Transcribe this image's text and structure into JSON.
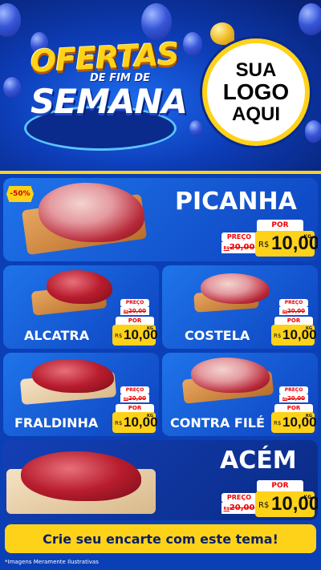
{
  "header": {
    "title_line1": "OFERTAS",
    "title_line2": "DE FIM DE",
    "title_line3": "SEMANA",
    "logo_line1": "SUA",
    "logo_line2": "LOGO",
    "logo_line3": "AQUI"
  },
  "colors": {
    "background": "#0b3fb5",
    "accent_yellow": "#ffd21a",
    "price_red": "#e00000"
  },
  "discount_badge": "-50%",
  "products": [
    {
      "name": "PICANHA",
      "preco_label": "PREÇO",
      "old_price": "20,00",
      "old_prefix": "R$",
      "por_label": "POR",
      "currency": "R$",
      "price": "10,00",
      "unit": "KG"
    },
    {
      "name": "ALCATRA",
      "preco_label": "PREÇO",
      "old_price": "20,00",
      "old_prefix": "R$",
      "por_label": "POR",
      "currency": "R$",
      "price": "10,00",
      "unit": "KG"
    },
    {
      "name": "COSTELA",
      "preco_label": "PREÇO",
      "old_price": "20,00",
      "old_prefix": "R$",
      "por_label": "POR",
      "currency": "R$",
      "price": "10,00",
      "unit": "KG"
    },
    {
      "name": "FRALDINHA",
      "preco_label": "PREÇO",
      "old_price": "20,00",
      "old_prefix": "R$",
      "por_label": "POR",
      "currency": "R$",
      "price": "10,00",
      "unit": "KG"
    },
    {
      "name": "CONTRA FILÉ",
      "preco_label": "PREÇO",
      "old_price": "20,00",
      "old_prefix": "R$",
      "por_label": "POR",
      "currency": "R$",
      "price": "10,00",
      "unit": "KG"
    },
    {
      "name": "ACÉM",
      "preco_label": "PREÇO",
      "old_price": "20,00",
      "old_prefix": "R$",
      "por_label": "POR",
      "currency": "R$",
      "price": "10,00",
      "unit": "KG"
    }
  ],
  "cta": "Crie seu encarte com este tema!",
  "footnote": "*Imagens Meramente Ilustrativas"
}
